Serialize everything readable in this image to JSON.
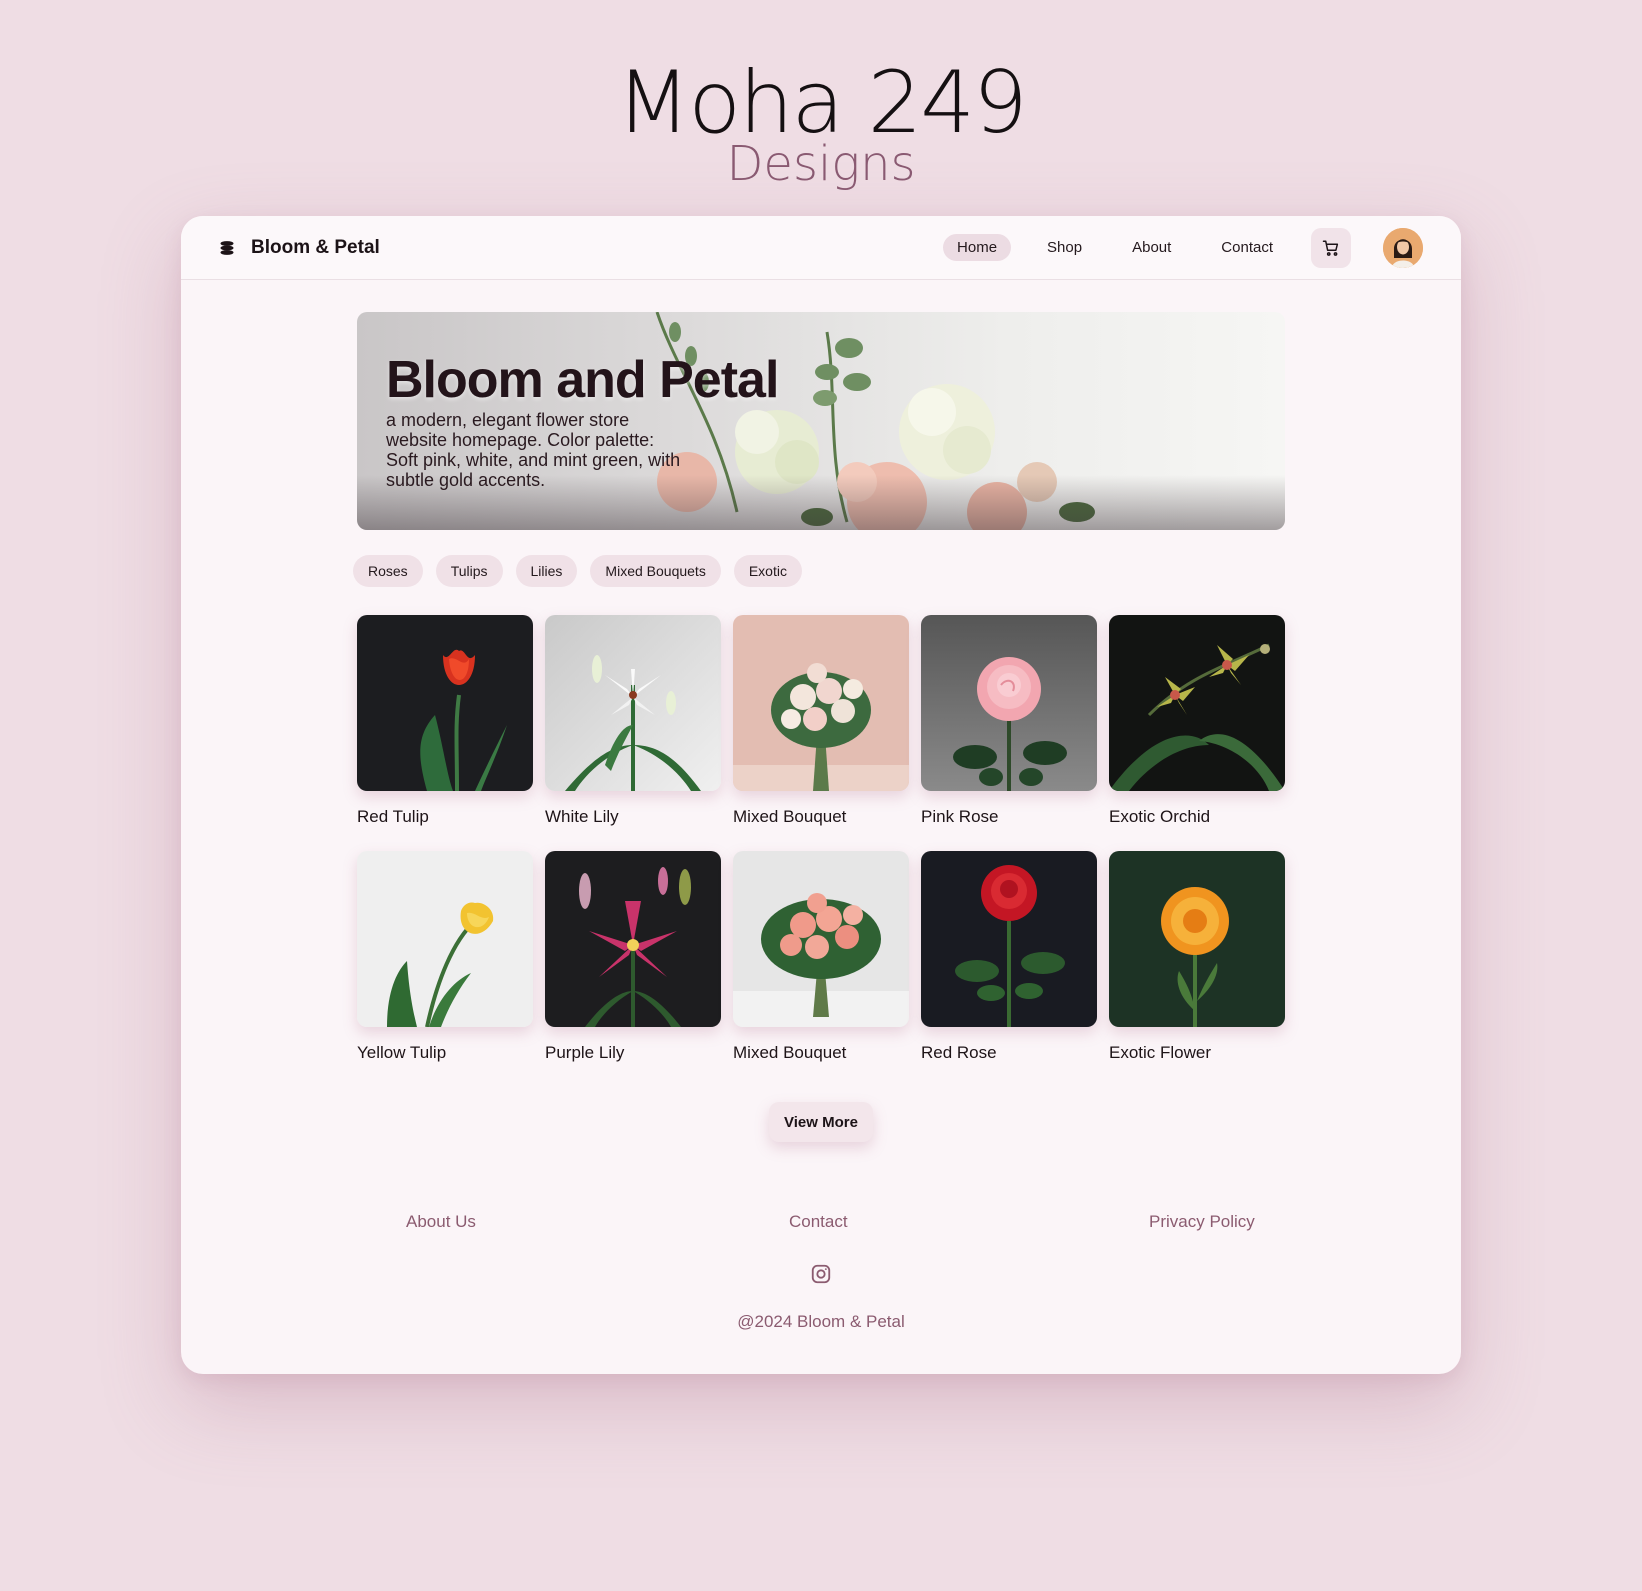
{
  "brand_mark": {
    "main": "Moha 249",
    "sub": "Designs"
  },
  "header": {
    "logo_text": "Bloom & Petal",
    "nav": [
      "Home",
      "Shop",
      "About",
      "Contact"
    ],
    "active_nav": "Home"
  },
  "hero": {
    "title": "Bloom and Petal",
    "subtitle": "a modern, elegant flower store website homepage. Color palette: Soft pink, white, and mint green, with subtle gold accents."
  },
  "categories": [
    "Roses",
    "Tulips",
    "Lilies",
    "Mixed Bouquets",
    "Exotic"
  ],
  "products": [
    {
      "label": "Red Tulip",
      "icon": "red-tulip-image"
    },
    {
      "label": "White Lily",
      "icon": "white-lily-image"
    },
    {
      "label": "Mixed Bouquet",
      "icon": "pink-bouquet-image"
    },
    {
      "label": "Pink Rose",
      "icon": "pink-rose-image"
    },
    {
      "label": "Exotic Orchid",
      "icon": "orchid-image"
    },
    {
      "label": "Yellow Tulip",
      "icon": "yellow-tulip-image"
    },
    {
      "label": "Purple Lily",
      "icon": "purple-lily-image"
    },
    {
      "label": "Mixed Bouquet",
      "icon": "coral-bouquet-image"
    },
    {
      "label": "Red Rose",
      "icon": "red-rose-image"
    },
    {
      "label": "Exotic Flower",
      "icon": "orange-flower-image"
    }
  ],
  "view_more": "View More",
  "footer": {
    "links": [
      "About Us",
      "Contact",
      "Privacy Policy"
    ],
    "copyright": "@2024 Bloom & Petal"
  },
  "colors": {
    "page_bg": "#efdde4",
    "card_bg": "#fbf5f8",
    "chip_bg": "#f0e1e7",
    "footer_text": "#8b5b70"
  }
}
